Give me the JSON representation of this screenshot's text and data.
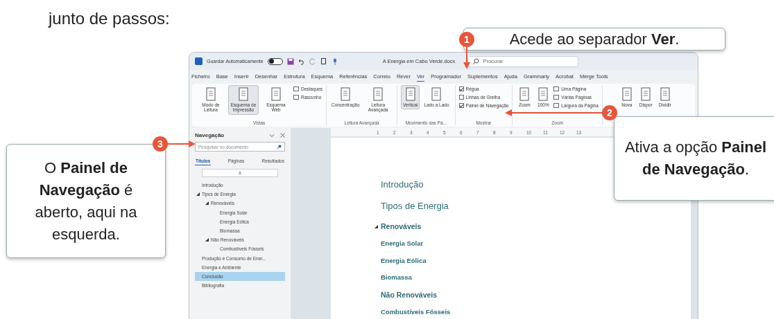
{
  "intro_text": "junto de passos:",
  "window": {
    "title_bar": {
      "autosave_label": "Guardar Automaticamente",
      "autosave_on": false,
      "document_title": "A Energia em Cabo Verde.docx",
      "search_placeholder": "Procurar"
    },
    "menu": [
      {
        "label": "Ficheiro",
        "selected": false
      },
      {
        "label": "Base",
        "selected": false
      },
      {
        "label": "Inserir",
        "selected": false
      },
      {
        "label": "Desenhar",
        "selected": false
      },
      {
        "label": "Estrutura",
        "selected": false
      },
      {
        "label": "Esquema",
        "selected": false
      },
      {
        "label": "Referências",
        "selected": false
      },
      {
        "label": "Correio",
        "selected": false
      },
      {
        "label": "Rever",
        "selected": false
      },
      {
        "label": "Ver",
        "selected": true
      },
      {
        "label": "Programador",
        "selected": false
      },
      {
        "label": "Suplementos",
        "selected": false
      },
      {
        "label": "Ajuda",
        "selected": false
      },
      {
        "label": "Grammarly",
        "selected": false
      },
      {
        "label": "Acrobat",
        "selected": false
      },
      {
        "label": "Merge Tools",
        "selected": false
      }
    ],
    "ribbon": [
      {
        "label": "Vistas",
        "items": [
          {
            "kind": "large",
            "label": "Modo de Leitura",
            "selected": false
          },
          {
            "kind": "large",
            "label": "Esquema de Impressão",
            "selected": true
          },
          {
            "kind": "large",
            "label": "Esquema Web",
            "selected": false
          },
          {
            "kind": "small",
            "label": "Destaques"
          },
          {
            "kind": "small",
            "label": "Rascunho"
          }
        ]
      },
      {
        "label": "Leitura Avançada",
        "items": [
          {
            "kind": "large",
            "label": "Concentração",
            "selected": false
          },
          {
            "kind": "large",
            "label": "Leitura Avançada",
            "selected": false
          }
        ]
      },
      {
        "label": "Movimento das Pá...",
        "items": [
          {
            "kind": "large",
            "label": "Vertical",
            "selected": true
          },
          {
            "kind": "large",
            "label": "Lado a Lado",
            "selected": false
          }
        ]
      },
      {
        "label": "Mostrar",
        "items": [
          {
            "kind": "check",
            "label": "Régua",
            "checked": true
          },
          {
            "kind": "check",
            "label": "Linhas de Grelha",
            "checked": false
          },
          {
            "kind": "check",
            "label": "Painel de Navegação",
            "checked": true
          }
        ]
      },
      {
        "label": "Zoom",
        "items": [
          {
            "kind": "large",
            "label": "Zoom",
            "selected": false
          },
          {
            "kind": "large",
            "label": "100%",
            "selected": false
          },
          {
            "kind": "small",
            "label": "Uma Página"
          },
          {
            "kind": "small",
            "label": "Várias Páginas"
          },
          {
            "kind": "small",
            "label": "Largura da Página"
          }
        ]
      },
      {
        "items": [
          {
            "kind": "large",
            "label": "Nova",
            "selected": false
          },
          {
            "kind": "large",
            "label": "Dispor",
            "selected": false
          },
          {
            "kind": "large",
            "label": "Dividir",
            "selected": false
          }
        ]
      }
    ],
    "navigation_pane": {
      "title": "Navegação",
      "search_placeholder": "Pesquisar no documento",
      "tabs": [
        {
          "label": "Títulos",
          "selected": true
        },
        {
          "label": "Páginas",
          "selected": false
        },
        {
          "label": "Resultados",
          "selected": false
        }
      ],
      "filter_chip": "x",
      "tree": [
        {
          "label": "Introdução",
          "selected": false
        },
        {
          "label": "Tipos de Energia",
          "selected": false,
          "expanded": true,
          "children": [
            {
              "label": "Renováveis",
              "selected": false,
              "expanded": true,
              "children": [
                {
                  "label": "Energia Solar",
                  "selected": false
                },
                {
                  "label": "Energia Eólica",
                  "selected": false
                },
                {
                  "label": "Biomassa",
                  "selected": false
                }
              ]
            },
            {
              "label": "Não Renováveis",
              "selected": false,
              "expanded": true,
              "children": [
                {
                  "label": "Combustíveis Fósseis",
                  "selected": false
                }
              ]
            }
          ]
        },
        {
          "label": "Produção e Consumo de Ener...",
          "selected": false
        },
        {
          "label": "Energia e Ambiente",
          "selected": false
        },
        {
          "label": "Conclusão",
          "selected": true
        },
        {
          "label": "Bibliografia",
          "selected": false
        }
      ]
    },
    "document": {
      "ruler": [
        "1",
        "2",
        "3",
        "4",
        "5",
        "6",
        "7",
        "8",
        "9",
        "10",
        "11",
        "12",
        "13"
      ],
      "headings": [
        {
          "kind": "title",
          "text": "Introdução",
          "show_toggle": false
        },
        {
          "kind": "title",
          "text": "Tipos de Energia",
          "show_toggle": false
        },
        {
          "kind": "heading",
          "text": "Renováveis",
          "show_toggle": true
        },
        {
          "kind": "subheading",
          "text": "Energia Solar",
          "show_toggle": false
        },
        {
          "kind": "subheading",
          "text": "Energia Eólica",
          "show_toggle": false
        },
        {
          "kind": "subheading",
          "text": "Biomassa",
          "show_toggle": false
        },
        {
          "kind": "heading",
          "text": "Não Renováveis",
          "show_toggle": false
        },
        {
          "kind": "subheading",
          "text": "Combustíveis Fósseis",
          "show_toggle": false
        }
      ]
    }
  },
  "callouts": [
    {
      "marker": "1",
      "text": "Acede ao separador **Ver**."
    },
    {
      "marker": "2",
      "text": "Ativa a opção **Painel de Navegação**."
    },
    {
      "marker": "3",
      "text": "O **Painel de Navegação** é aberto, aqui na esquerda."
    }
  ]
}
